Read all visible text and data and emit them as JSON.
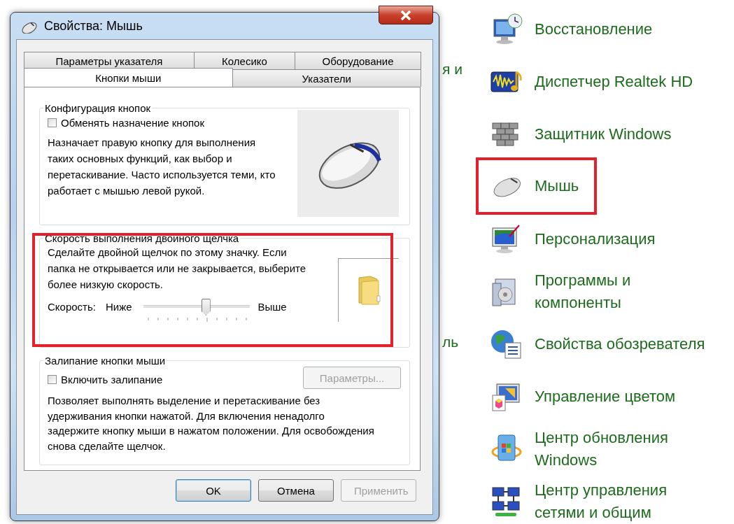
{
  "dialog": {
    "title": "Свойства: Мышь",
    "tab_rows": [
      {
        "tabs": [
          {
            "label": "Параметры указателя",
            "selected": false
          },
          {
            "label": "Колесико",
            "selected": false
          },
          {
            "label": "Оборудование",
            "selected": false
          }
        ]
      },
      {
        "tabs": [
          {
            "label": "Кнопки мыши",
            "selected": true
          },
          {
            "label": "Указатели",
            "selected": false
          }
        ]
      }
    ],
    "groups": [
      {
        "kind": "buttons-config",
        "title": "Конфигурация кнопок",
        "highlighted": false,
        "checkbox": {
          "label": "Обменять назначение кнопок",
          "checked": false
        },
        "description": "Назначает правую кнопку для выполнения таких основных функций, как выбор и перетаскивание. Часто используется теми, кто работает с мышью левой рукой."
      },
      {
        "kind": "double-click",
        "title": "Скорость выполнения двойного щелчка",
        "highlighted": true,
        "description": "Сделайте двойной щелчок по этому значку. Если папка не открывается или не закрывается, выберите более низкую скорость.",
        "speed_label": "Скорость:",
        "min_label": "Ниже",
        "max_label": "Выше",
        "level": 0.58
      },
      {
        "kind": "click-lock",
        "title": "Залипание кнопки мыши",
        "highlighted": false,
        "checkbox": {
          "label": "Включить залипание",
          "checked": false
        },
        "settings_button": {
          "label": "Параметры...",
          "disabled": true
        },
        "description": "Позволяет выполнять выделение и перетаскивание без удерживания кнопки нажатой. Для включения ненадолго задержите кнопку мыши в нажатом положении. Для освобождения снова сделайте щелчок."
      }
    ],
    "buttons": [
      {
        "label": "OK",
        "default": true,
        "disabled": false
      },
      {
        "label": "Отмена",
        "default": false,
        "disabled": false
      },
      {
        "label": "Применить",
        "default": false,
        "disabled": true
      }
    ]
  },
  "background_fragments": [
    {
      "text": "я и"
    },
    {
      "text": "ль"
    }
  ],
  "control_panel": {
    "items": [
      {
        "label": "Восстановление",
        "highlighted": false
      },
      {
        "label": "Диспетчер Realtek HD",
        "highlighted": false
      },
      {
        "label": "Защитник Windows",
        "highlighted": false
      },
      {
        "label": "Мышь",
        "highlighted": true
      },
      {
        "label": "Персонализация",
        "highlighted": false
      },
      {
        "label": "Программы и\nкомпоненты",
        "highlighted": false
      },
      {
        "label": "Свойства обозревателя",
        "highlighted": false
      },
      {
        "label": "Управление цветом",
        "highlighted": false
      },
      {
        "label": "Центр обновления\nWindows",
        "highlighted": false
      },
      {
        "label": "Центр управления\nсетями и общим",
        "highlighted": false
      }
    ]
  }
}
